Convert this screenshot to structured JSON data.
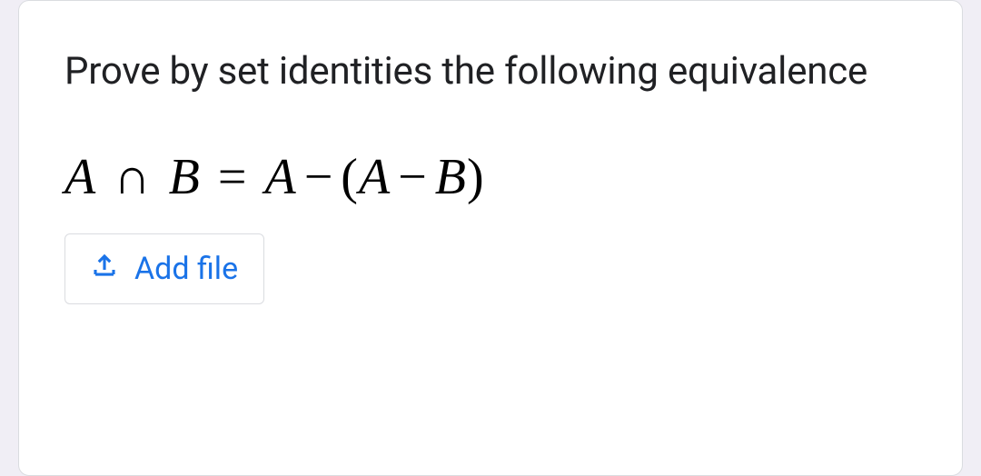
{
  "question": {
    "prompt": "Prove by set identities the following equivalence",
    "equation_plain": "A ∩ B = A − (A − B)"
  },
  "actions": {
    "add_file_label": "Add file"
  }
}
